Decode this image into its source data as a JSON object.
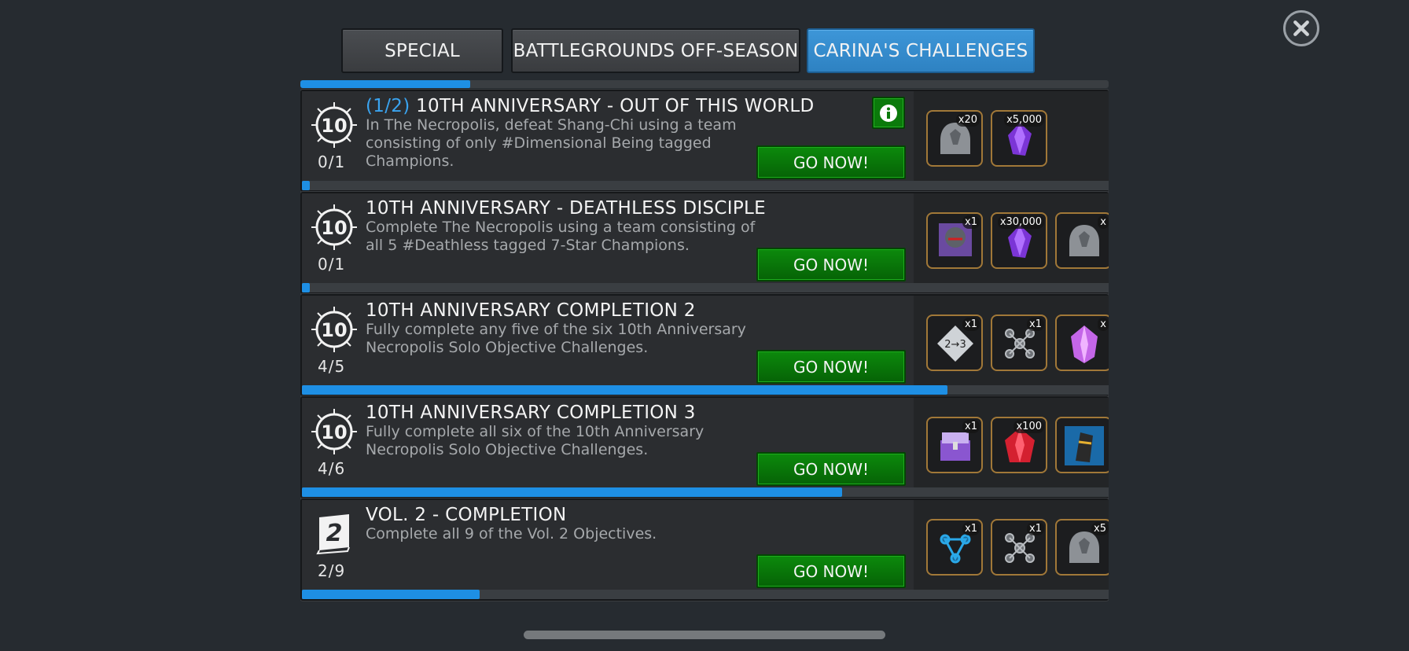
{
  "tabs": [
    {
      "label": "SPECIAL",
      "active": false
    },
    {
      "label": "BATTLEGROUNDS OFF-SEASON",
      "active": false
    },
    {
      "label": "CARINA'S CHALLENGES",
      "active": true
    }
  ],
  "top_progress": 0.21,
  "cards": [
    {
      "fraction": "(1/2)",
      "title": "10TH ANNIVERSARY - OUT OF THIS WORLD",
      "description": "In The Necropolis, defeat Shang-Chi using a team consisting of only #Dimensional Being tagged Champions.",
      "count": "0/1",
      "progress": 0.01,
      "button": "GO NOW!",
      "has_info": true,
      "badge_icon": "anniversary-10-icon",
      "rewards": [
        {
          "icon": "champion-shard-icon",
          "qty": "x20"
        },
        {
          "icon": "purple-crystal-icon",
          "qty": "x5,000"
        }
      ]
    },
    {
      "fraction": "",
      "title": "10TH ANNIVERSARY - DEATHLESS DISCIPLE",
      "description": "Complete The Necropolis using a team consisting of all 5 #Deathless tagged 7-Star Champions.",
      "count": "0/1",
      "progress": 0.01,
      "button": "GO NOW!",
      "has_info": false,
      "badge_icon": "anniversary-10-icon",
      "rewards": [
        {
          "icon": "champion-portrait-icon",
          "qty": "x1"
        },
        {
          "icon": "purple-crystal-icon",
          "qty": "x30,000"
        },
        {
          "icon": "champion-shard-icon",
          "qty": "x"
        }
      ]
    },
    {
      "fraction": "",
      "title": "10TH ANNIVERSARY COMPLETION 2",
      "description": "Fully complete any five of the six 10th Anniversary Necropolis Solo Objective Challenges.",
      "count": "4/5",
      "progress": 0.8,
      "button": "GO NOW!",
      "has_info": false,
      "badge_icon": "anniversary-10-icon",
      "rewards": [
        {
          "icon": "rank-up-gem-icon",
          "qty": "x1"
        },
        {
          "icon": "catalyst-icon",
          "qty": "x1"
        },
        {
          "icon": "pink-crystal-icon",
          "qty": "x"
        }
      ]
    },
    {
      "fraction": "",
      "title": "10TH ANNIVERSARY COMPLETION 3",
      "description": "Fully complete all six of the 10th Anniversary Necropolis Solo Objective Challenges.",
      "count": "4/6",
      "progress": 0.67,
      "button": "GO NOW!",
      "has_info": false,
      "badge_icon": "anniversary-10-icon",
      "rewards": [
        {
          "icon": "chest-icon",
          "qty": "x1"
        },
        {
          "icon": "red-crystal-icon",
          "qty": "x100"
        },
        {
          "icon": "gauntlet-icon",
          "qty": ""
        }
      ]
    },
    {
      "fraction": "",
      "title": "VOL. 2 - COMPLETION",
      "description": "Complete all 9 of the Vol. 2 Objectives.",
      "count": "2/9",
      "progress": 0.22,
      "button": "GO NOW!",
      "has_info": false,
      "badge_icon": "book-volume-2-icon",
      "rewards": [
        {
          "icon": "catalyst-blue-icon",
          "qty": "x1"
        },
        {
          "icon": "catalyst-icon",
          "qty": "x1"
        },
        {
          "icon": "champion-shard-icon",
          "qty": "x5"
        }
      ]
    }
  ],
  "colors": {
    "accent": "#1e8fe4",
    "go_button": "#0a7a0a",
    "reward_border": "#a17838"
  }
}
